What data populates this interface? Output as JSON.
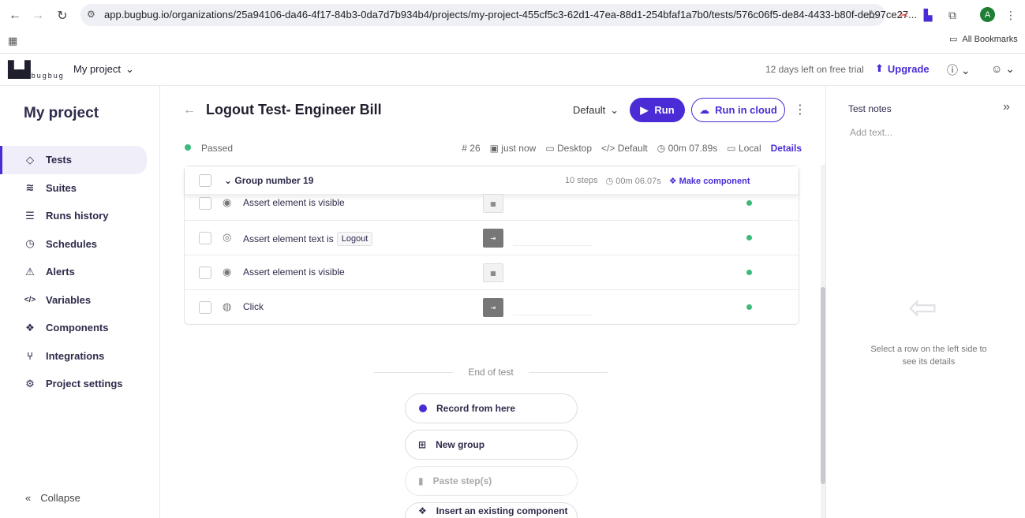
{
  "browser": {
    "url": "app.bugbug.io/organizations/25a94106-da46-4f17-84b3-0da7d7b934b4/projects/my-project-455cf5c3-62d1-47ea-88d1-254bfaf1a7b0/tests/576c06f5-de84-4433-b80f-deb97ce27...",
    "avatar_letter": "A",
    "bookmarks_label": "All Bookmarks"
  },
  "header": {
    "logo_text": "bugbug",
    "project_selector": "My project",
    "trial_text": "12 days left on free trial",
    "upgrade_label": "Upgrade"
  },
  "sidebar": {
    "project_title": "My project",
    "items": [
      {
        "label": "Tests",
        "icon": "diamond-icon",
        "glyph": "◇"
      },
      {
        "label": "Suites",
        "icon": "layers-icon",
        "glyph": "≋"
      },
      {
        "label": "Runs history",
        "icon": "list-play-icon",
        "glyph": "☰"
      },
      {
        "label": "Schedules",
        "icon": "clock-history-icon",
        "glyph": "◷"
      },
      {
        "label": "Alerts",
        "icon": "siren-icon",
        "glyph": "⚠"
      },
      {
        "label": "Variables",
        "icon": "code-icon",
        "glyph": "</>"
      },
      {
        "label": "Components",
        "icon": "components-icon",
        "glyph": "❖"
      },
      {
        "label": "Integrations",
        "icon": "git-icon",
        "glyph": "⑂"
      },
      {
        "label": "Project settings",
        "icon": "gear-icon",
        "glyph": "⚙"
      }
    ],
    "collapse_label": "Collapse"
  },
  "test": {
    "title": "Logout Test- Engineer Bill",
    "profile": "Default",
    "run_label": "Run",
    "run_cloud_label": "Run in cloud",
    "status": "Passed",
    "run_number": "# 26",
    "time": "just now",
    "device": "Desktop",
    "profile_meta": "Default",
    "duration": "00m 07.89s",
    "location": "Local",
    "details_label": "Details"
  },
  "group": {
    "name": "Group number 19",
    "steps_count": "10 steps",
    "duration": "00m 06.07s",
    "make_component": "Make component"
  },
  "steps": [
    {
      "text": "Assert element is visible",
      "icon": "eye-icon",
      "value": "",
      "thumb": "light"
    },
    {
      "text": "Assert element text is",
      "icon": "eye-text-icon",
      "value": "Logout",
      "thumb": "dark"
    },
    {
      "text": "Assert element is visible",
      "icon": "eye-icon",
      "value": "",
      "thumb": "light"
    },
    {
      "text": "Click",
      "icon": "mouse-icon",
      "value": "",
      "thumb": "dark"
    }
  ],
  "end_of_test": "End of test",
  "actions": {
    "record": "Record from here",
    "new_group": "New group",
    "paste": "Paste step(s)",
    "insert": "Insert an existing component"
  },
  "notes": {
    "title": "Test notes",
    "placeholder": "Add text...",
    "hint": "Select a row on the left side to see its details"
  },
  "colors": {
    "accent": "#4a2bd6",
    "success": "#3cba7b"
  }
}
